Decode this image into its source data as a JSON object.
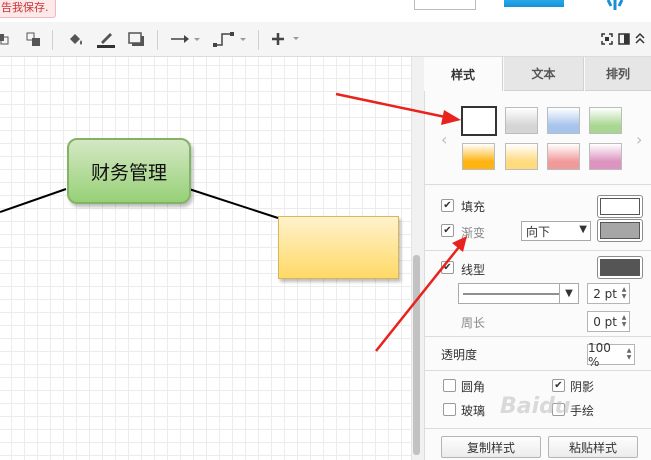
{
  "notice": {
    "text": "告我保存."
  },
  "toolbar": {
    "icons": [
      "to-back-icon",
      "to-front-icon",
      "fill-color-icon",
      "line-color-icon",
      "shadow-icon",
      "connection-icon",
      "waypoints-icon",
      "insert-icon",
      "fit-icon",
      "format-panel-icon",
      "collapse-icon"
    ]
  },
  "canvas": {
    "node1_label": "财务管理",
    "colors": {
      "green_stroke": "#82b366",
      "green_fill": "#97d077",
      "yellow_stroke": "#d6b656",
      "yellow_fill": "#ffd966"
    }
  },
  "panel": {
    "tabs": [
      {
        "label": "样式",
        "active": true
      },
      {
        "label": "文本"
      },
      {
        "label": "排列"
      }
    ],
    "swatches": [
      "#ffffff",
      "#d5d5d5",
      "#a7c4ed",
      "#a9d792",
      "#ffb412",
      "#ffdb80",
      "#f19a9a",
      "#dd94c0"
    ],
    "fill_label": "填充",
    "gradient_label": "渐变",
    "gradient_direction": "向下",
    "line_label": "线型",
    "line_width": "2 pt",
    "perimeter_label": "周长",
    "perimeter_value": "0 pt",
    "opacity_label": "透明度",
    "opacity_value": "100 %",
    "rounded_label": "圆角",
    "shadow_label": "阴影",
    "glass_label": "玻璃",
    "sketch_label": "手绘",
    "copy_style_label": "复制样式",
    "paste_style_label": "粘贴样式",
    "fill_color": "#ffffff",
    "gradient_color": "#a6a6a6",
    "line_color": "#555555"
  },
  "watermark": "Baidu"
}
